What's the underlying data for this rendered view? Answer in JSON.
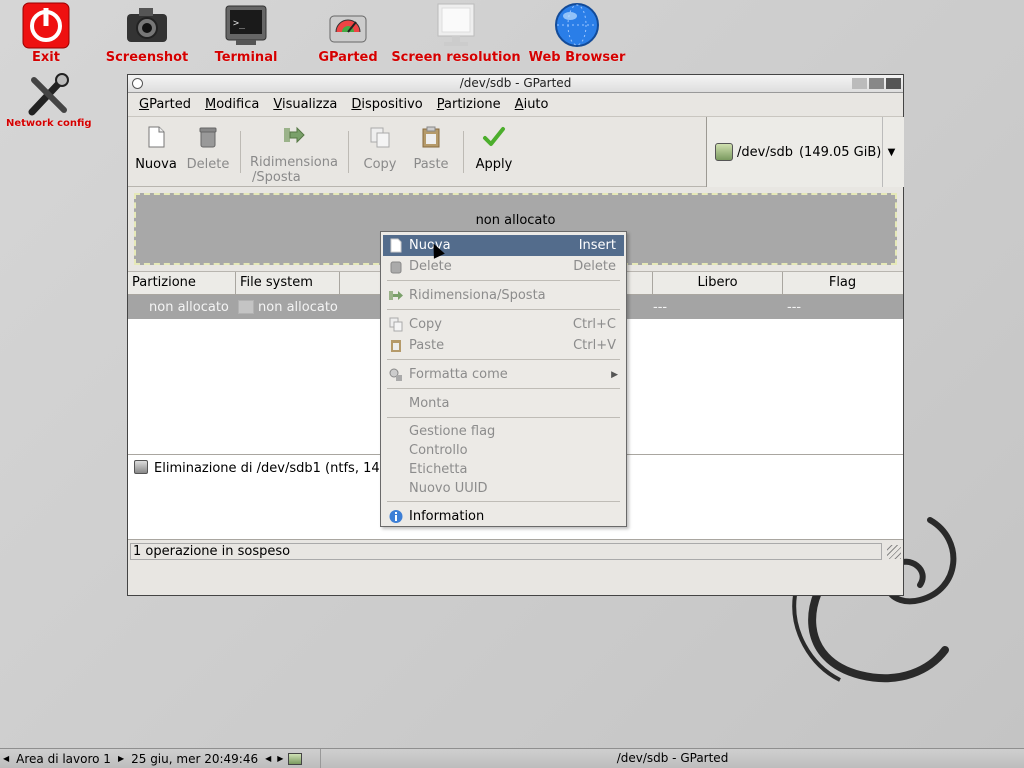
{
  "desktop": {
    "icons": [
      {
        "label": "Exit",
        "icon": "power-icon"
      },
      {
        "label": "Screenshot",
        "icon": "camera-icon"
      },
      {
        "label": "Terminal",
        "icon": "terminal-icon"
      },
      {
        "label": "GParted",
        "icon": "disk-icon"
      },
      {
        "label": "Screen resolution",
        "icon": "monitor-icon"
      },
      {
        "label": "Web Browser",
        "icon": "globe-icon"
      },
      {
        "label": "Network config",
        "icon": "tools-icon"
      }
    ],
    "label_color": "#d40000"
  },
  "window": {
    "title": "/dev/sdb - GParted",
    "menu": [
      {
        "label": "GParted",
        "mnemonic": "G",
        "rest": "Parted"
      },
      {
        "label": "Modifica",
        "mnemonic": "M",
        "rest": "odifica"
      },
      {
        "label": "Visualizza",
        "mnemonic": "V",
        "rest": "isualizza"
      },
      {
        "label": "Dispositivo",
        "mnemonic": "D",
        "rest": "ispositivo"
      },
      {
        "label": "Partizione",
        "mnemonic": "P",
        "rest": "artizione"
      },
      {
        "label": "Aiuto",
        "mnemonic": "A",
        "rest": "iuto"
      }
    ],
    "toolbar": {
      "nuova": "Nuova",
      "delete": "Delete",
      "resize_line1": "Ridimensiona",
      "resize_line2": "/Sposta",
      "copy": "Copy",
      "paste": "Paste",
      "apply": "Apply"
    },
    "device": {
      "path": "/dev/sdb",
      "size": "(149.05 GiB)"
    },
    "disk_map": {
      "label": "non allocato"
    },
    "table": {
      "headers": [
        "Partizione",
        "File system",
        "Libero",
        "Flag"
      ],
      "row": {
        "partition": "non allocato",
        "filesystem": "non allocato",
        "used": "---",
        "free": "---"
      }
    },
    "operations": {
      "text": "Eliminazione di /dev/sdb1 (ntfs, 149"
    },
    "status": "1 operazione in sospeso"
  },
  "context_menu": {
    "items": [
      {
        "label": "Nuova",
        "accel": "Insert"
      },
      {
        "label": "Delete",
        "accel": "Delete"
      },
      {
        "label": "Ridimensiona/Sposta",
        "accel": ""
      },
      {
        "label": "Copy",
        "accel": "Ctrl+C"
      },
      {
        "label": "Paste",
        "accel": "Ctrl+V"
      },
      {
        "label": "Formatta come",
        "accel": ""
      },
      {
        "label": "Monta",
        "accel": ""
      },
      {
        "label": "Gestione flag",
        "accel": ""
      },
      {
        "label": "Controllo",
        "accel": ""
      },
      {
        "label": "Etichetta",
        "accel": ""
      },
      {
        "label": "Nuovo UUID",
        "accel": ""
      },
      {
        "label": "Information",
        "accel": ""
      }
    ],
    "selected_color": "#536c8c"
  },
  "taskbar": {
    "workspace": "Area di lavoro 1",
    "clock": "25 giu, mer 20:49:46",
    "window_task": "/dev/sdb - GParted"
  }
}
